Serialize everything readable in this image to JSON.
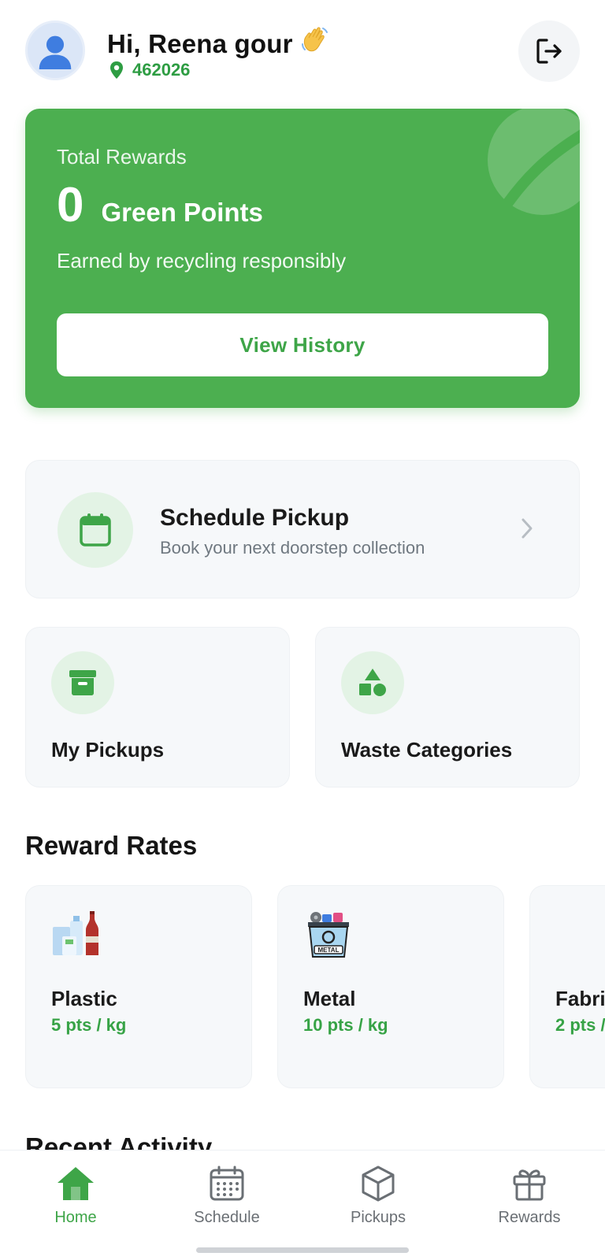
{
  "header": {
    "greeting": "Hi, Reena gour",
    "location_pincode": "462026"
  },
  "rewards_card": {
    "label": "Total Rewards",
    "points": "0",
    "unit": "Green Points",
    "subtitle": "Earned by recycling responsibly",
    "button_label": "View History"
  },
  "schedule": {
    "title": "Schedule Pickup",
    "description": "Book your next doorstep collection"
  },
  "tiles": {
    "my_pickups": "My Pickups",
    "waste_categories": "Waste Categories"
  },
  "reward_rates": {
    "title": "Reward Rates",
    "items": [
      {
        "name": "Plastic",
        "rate": "5 pts / kg"
      },
      {
        "name": "Metal",
        "rate": "10 pts / kg"
      },
      {
        "name": "Fabri",
        "rate": "2 pts /"
      }
    ]
  },
  "recent_activity": {
    "title": "Recent Activity"
  },
  "bottom_nav": {
    "items": [
      {
        "label": "Home",
        "active": true
      },
      {
        "label": "Schedule"
      },
      {
        "label": "Pickups"
      },
      {
        "label": "Rewards"
      }
    ]
  },
  "colors": {
    "primary_green": "#4caf50",
    "accent_green": "#3ea548",
    "card_bg": "#f6f8fa"
  }
}
